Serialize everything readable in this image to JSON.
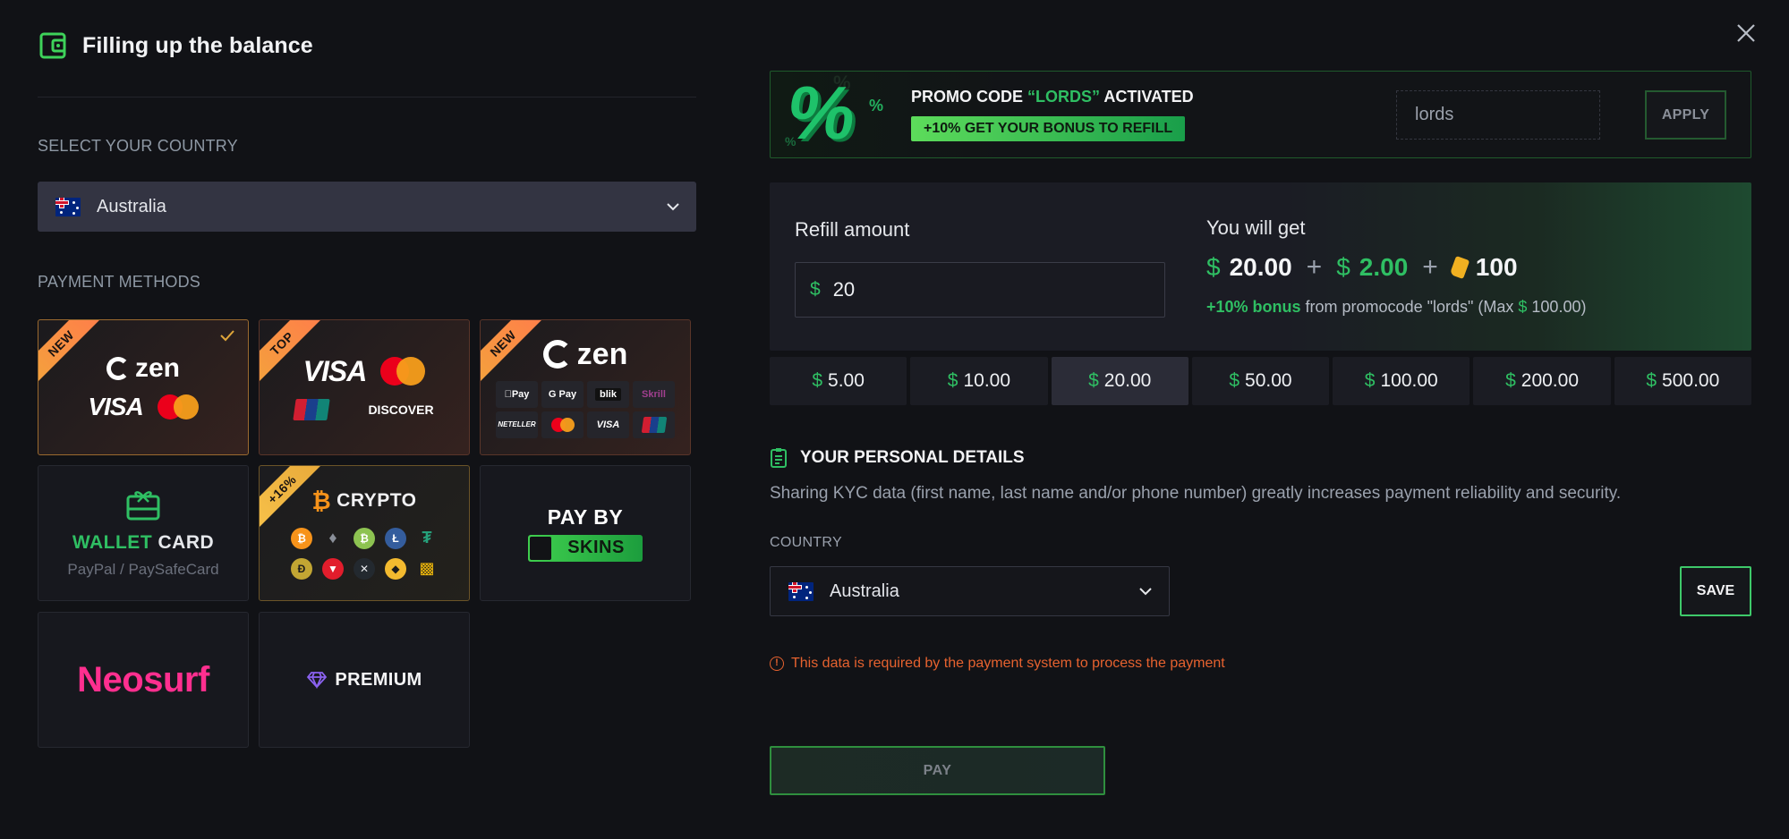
{
  "header": {
    "title": "Filling up the balance",
    "icon": "wallet-icon",
    "close_icon": "close-icon"
  },
  "country_section": {
    "label": "SELECT YOUR COUNTRY",
    "selected": "Australia",
    "flag": "australia-flag"
  },
  "payment_methods": {
    "label": "PAYMENT METHODS",
    "items": [
      {
        "id": "zen-cards",
        "badge": "NEW",
        "selected": true,
        "brand": "zen",
        "logos": [
          "VISA",
          "mastercard"
        ]
      },
      {
        "id": "cards",
        "badge": "TOP",
        "selected": false,
        "logos": [
          "VISA",
          "mastercard",
          "UnionPay",
          "DISCOVER"
        ]
      },
      {
        "id": "zen-wallets",
        "badge": "NEW",
        "selected": false,
        "brand": "zen",
        "logos": [
          "Pay",
          "G Pay",
          "blik",
          "Skrill",
          "NETELLER",
          "mastercard",
          "VISA",
          "UnionPay"
        ]
      },
      {
        "id": "wallet-card",
        "badge": "",
        "title_green": "WALLET",
        "title_white": "CARD",
        "subtitle": "PayPal / PaySafeCard"
      },
      {
        "id": "crypto",
        "badge": "+16%",
        "title": "CRYPTO",
        "coins": [
          "BTC",
          "ETH",
          "BCH",
          "LTC",
          "USDT",
          "DOGE",
          "TRX",
          "XRP",
          "BNB",
          "BUSD"
        ]
      },
      {
        "id": "skins",
        "badge": "",
        "line1": "PAY BY",
        "line2": "SKINS"
      },
      {
        "id": "neosurf",
        "badge": "",
        "title": "Neosurf"
      },
      {
        "id": "premium",
        "badge": "",
        "title": "PREMIUM"
      }
    ]
  },
  "promo": {
    "title_prefix": "PROMO CODE ",
    "code_quoted": "“LORDS”",
    "title_suffix": " ACTIVATED",
    "badge": "+10% GET YOUR BONUS TO REFILL",
    "input_value": "lords",
    "apply_label": "APPLY"
  },
  "refill": {
    "label": "Refill amount",
    "currency_symbol": "$",
    "value": "20",
    "get_label": "You will get",
    "amount": "20.00",
    "bonus_amount": "2.00",
    "coins": "100",
    "bonus_highlight": "+10% bonus",
    "bonus_text": " from promocode \"lords\" (Max ",
    "bonus_max": " 100.00)"
  },
  "quick_amounts": [
    {
      "value": "5.00",
      "active": false
    },
    {
      "value": "10.00",
      "active": false
    },
    {
      "value": "20.00",
      "active": true
    },
    {
      "value": "50.00",
      "active": false
    },
    {
      "value": "100.00",
      "active": false
    },
    {
      "value": "200.00",
      "active": false
    },
    {
      "value": "500.00",
      "active": false
    }
  ],
  "personal": {
    "title": "YOUR PERSONAL DETAILS",
    "description": "Sharing KYC data (first name, last name and/or phone number) greatly increases payment reliability and security.",
    "country_label": "COUNTRY",
    "country_value": "Australia",
    "save_label": "SAVE",
    "warning": "This data is required by the payment system to process the payment"
  },
  "pay": {
    "label": "PAY"
  },
  "colors": {
    "accent_green": "#2fbf63",
    "warning_orange": "#e6622f",
    "background": "#111216",
    "ribbon_orange": "#f3a33c",
    "neosurf_pink": "#ff2f8f"
  }
}
